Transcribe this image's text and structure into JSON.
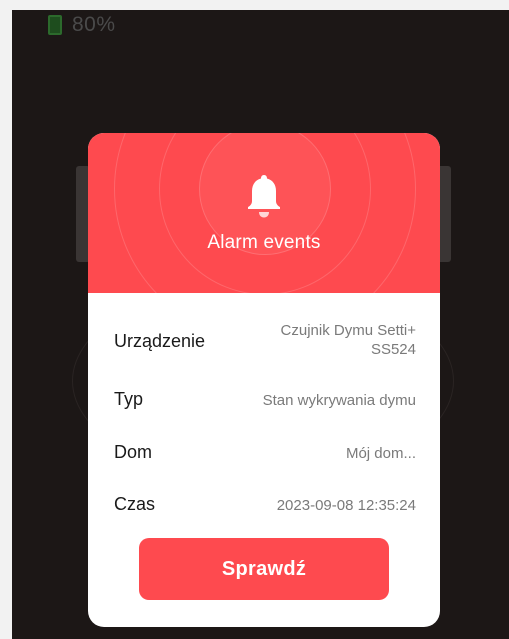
{
  "status_bar": {
    "battery": "80%"
  },
  "dialog": {
    "icon": "bell-icon",
    "title": "Alarm events",
    "rows": [
      {
        "label": "Urządzenie",
        "value": "Czujnik Dymu Setti+ SS524"
      },
      {
        "label": "Typ",
        "value": "Stan wykrywania dymu"
      },
      {
        "label": "Dom",
        "value": "Mój dom..."
      },
      {
        "label": "Czas",
        "value": "2023-09-08 12:35:24"
      }
    ],
    "button_label": "Sprawdź"
  },
  "colors": {
    "accent": "#fe4a4f",
    "backdrop": "#1c1716",
    "battery": "#2c6a2c"
  }
}
